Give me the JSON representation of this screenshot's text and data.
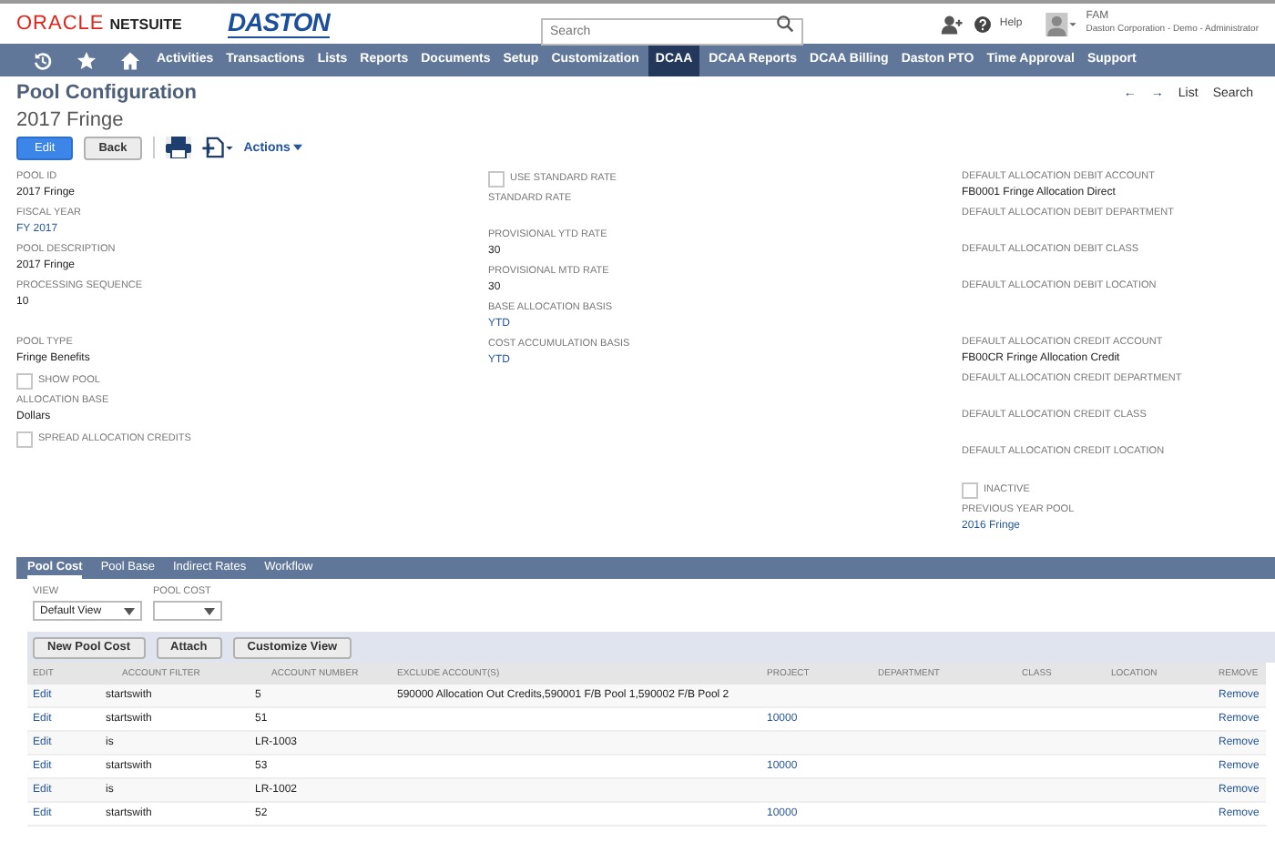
{
  "header": {
    "oracle": "ORACLE",
    "netsuite": "NETSUITE",
    "company_logo": "DASTON",
    "search": {
      "placeholder": "Search"
    },
    "help": "Help",
    "user": {
      "name": "FAM",
      "role": "Daston Corporation - Demo - Administrator"
    }
  },
  "nav": [
    {
      "label": "Activities",
      "selected": false
    },
    {
      "label": "Transactions",
      "selected": false
    },
    {
      "label": "Lists",
      "selected": false
    },
    {
      "label": "Reports",
      "selected": false
    },
    {
      "label": "Documents",
      "selected": false
    },
    {
      "label": "Setup",
      "selected": false
    },
    {
      "label": "Customization",
      "selected": false
    },
    {
      "label": "DCAA",
      "selected": true
    },
    {
      "label": "DCAA Reports",
      "selected": false
    },
    {
      "label": "DCAA Billing",
      "selected": false
    },
    {
      "label": "Daston PTO",
      "selected": false
    },
    {
      "label": "Time Approval",
      "selected": false
    },
    {
      "label": "Support",
      "selected": false
    }
  ],
  "page": {
    "title": "Pool Configuration",
    "record": "2017 Fringe",
    "arrows": [
      "←",
      "→"
    ],
    "links": [
      "List",
      "Search"
    ]
  },
  "buttons": [
    {
      "label": "Edit",
      "kind": "primary"
    },
    {
      "label": "Back",
      "kind": "secondary"
    }
  ],
  "actions": "Actions",
  "columns": [
    [
      [
        {
          "kind": "field",
          "label": "POOL ID",
          "value": "2017 Fringe",
          "link": false
        },
        {
          "kind": "field",
          "label": "FISCAL YEAR",
          "value": "FY 2017",
          "link": true
        },
        {
          "kind": "field",
          "label": "POOL DESCRIPTION",
          "value": "2017 Fringe",
          "link": false
        },
        {
          "kind": "field",
          "label": "PROCESSING SEQUENCE",
          "value": "10",
          "link": false
        }
      ],
      [
        {
          "kind": "field",
          "label": "POOL TYPE",
          "value": "Fringe Benefits",
          "link": false
        },
        {
          "kind": "checkbox",
          "label": "SHOW POOL",
          "checked": false
        },
        {
          "kind": "field",
          "label": "ALLOCATION BASE",
          "value": "Dollars",
          "link": false
        },
        {
          "kind": "checkbox",
          "label": "SPREAD ALLOCATION CREDITS",
          "checked": false
        }
      ]
    ],
    [
      [
        {
          "kind": "checkbox",
          "label": "USE STANDARD RATE",
          "checked": false
        },
        {
          "kind": "field",
          "label": "STANDARD RATE"
        },
        {
          "kind": "field",
          "label": "PROVISIONAL YTD RATE",
          "value": "30",
          "link": false
        },
        {
          "kind": "field",
          "label": "PROVISIONAL MTD RATE",
          "value": "30",
          "link": false
        },
        {
          "kind": "field",
          "label": "BASE ALLOCATION BASIS",
          "value": "YTD",
          "link": true
        },
        {
          "kind": "field",
          "label": "COST ACCUMULATION BASIS",
          "value": "YTD",
          "link": true
        }
      ]
    ],
    [
      [
        {
          "kind": "field",
          "label": "DEFAULT ALLOCATION DEBIT ACCOUNT",
          "value": "FB0001 Fringe Allocation Direct",
          "link": false
        },
        {
          "kind": "field",
          "label": "DEFAULT ALLOCATION DEBIT DEPARTMENT"
        },
        {
          "kind": "field",
          "label": "DEFAULT ALLOCATION DEBIT CLASS"
        },
        {
          "kind": "field",
          "label": "DEFAULT ALLOCATION DEBIT LOCATION"
        }
      ],
      [
        {
          "kind": "field",
          "label": "DEFAULT ALLOCATION CREDIT ACCOUNT",
          "value": "FB00CR Fringe Allocation Credit",
          "link": false
        },
        {
          "kind": "field",
          "label": "DEFAULT ALLOCATION CREDIT DEPARTMENT"
        },
        {
          "kind": "field",
          "label": "DEFAULT ALLOCATION CREDIT CLASS"
        },
        {
          "kind": "field",
          "label": "DEFAULT ALLOCATION CREDIT LOCATION"
        },
        {
          "kind": "checkbox",
          "label": "INACTIVE",
          "checked": false
        },
        {
          "kind": "field",
          "label": "PREVIOUS YEAR POOL",
          "value": "2016 Fringe",
          "link": true
        }
      ]
    ]
  ],
  "subtabs": [
    {
      "label": "Pool Cost",
      "selected": true
    },
    {
      "label": "Pool Base",
      "selected": false
    },
    {
      "label": "Indirect Rates",
      "selected": false
    },
    {
      "label": "Workflow",
      "selected": false
    }
  ],
  "filters": [
    {
      "label": "VIEW",
      "value": "Default View"
    },
    {
      "label": "POOL COST"
    }
  ],
  "list_buttons": [
    "New Pool Cost",
    "Attach",
    "Customize View"
  ],
  "table": {
    "columns": [
      "EDIT",
      "ACCOUNT FILTER",
      "ACCOUNT NUMBER",
      "EXCLUDE ACCOUNT(S)",
      "PROJECT",
      "DEPARTMENT",
      "CLASS",
      "LOCATION",
      "REMOVE"
    ],
    "rows": [
      {
        "edit": "Edit",
        "filter": "startswith",
        "number": "5",
        "exclude": "590000 Allocation Out Credits,590001 F/B Pool 1,590002 F/B Pool 2",
        "remove": "Remove"
      },
      {
        "edit": "Edit",
        "filter": "startswith",
        "number": "51",
        "project": "10000",
        "remove": "Remove"
      },
      {
        "edit": "Edit",
        "filter": "is",
        "number": "LR-1003",
        "remove": "Remove"
      },
      {
        "edit": "Edit",
        "filter": "startswith",
        "number": "53",
        "project": "10000",
        "remove": "Remove"
      },
      {
        "edit": "Edit",
        "filter": "is",
        "number": "LR-1002",
        "remove": "Remove"
      },
      {
        "edit": "Edit",
        "filter": "startswith",
        "number": "52",
        "project": "10000",
        "remove": "Remove"
      }
    ]
  }
}
